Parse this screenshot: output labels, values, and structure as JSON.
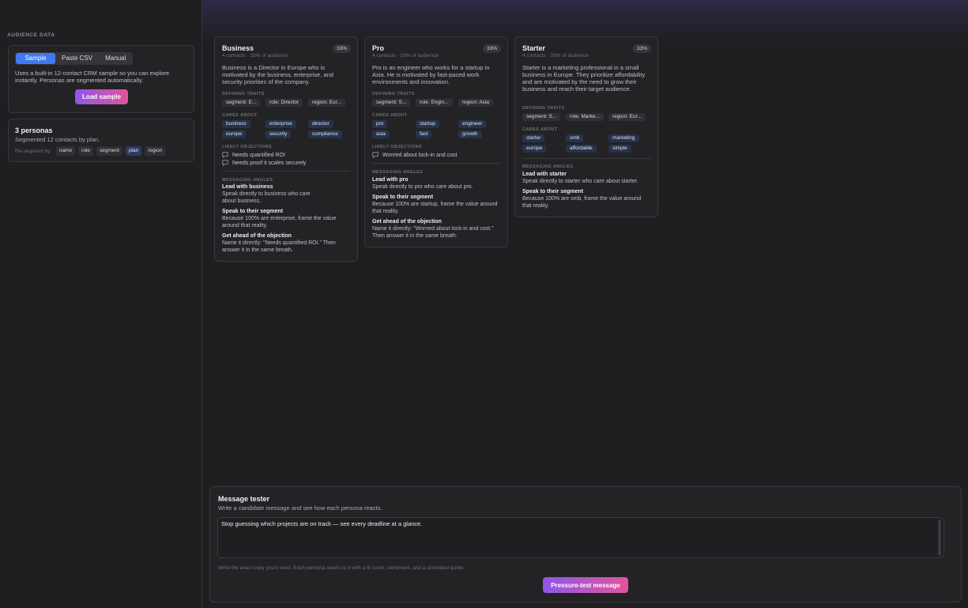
{
  "sidebar": {
    "section_label": "AUDIENCE DATA",
    "tabs": [
      "Sample",
      "Paste CSV",
      "Manual"
    ],
    "active_tab": "Sample",
    "description": "Uses a built-in 12-contact CRM sample so you can explore instantly. Personas are segmented automatically.",
    "load_button": "Load sample",
    "personas_title": "3 personas",
    "personas_subtitle": "Segmented 12 contacts by plan.",
    "resegment_label": "Re-segment by:",
    "resegment_options": [
      "name",
      "role",
      "segment",
      "plan",
      "region"
    ],
    "resegment_active": "plan"
  },
  "personas": [
    {
      "name": "Business",
      "share": "33%",
      "subtitle": "4 contacts · 33% of audience",
      "description": "Business is a Director in Europe who is motivated by the business, enterprise, and security priorities of the company.",
      "traits_label": "DEFINING TRAITS",
      "traits": [
        "segment: E...",
        "role: Director",
        "region: Eur..."
      ],
      "cares_label": "CARES ABOUT",
      "cares": [
        "business",
        "enterprise",
        "director",
        "europe",
        "security",
        "compliance"
      ],
      "objections_label": "LIKELY OBJECTIONS",
      "objections": [
        "Needs quantified ROI",
        "Needs proof it scales securely"
      ],
      "angles_label": "MESSAGING ANGLES",
      "angles": [
        {
          "title": "Lead with business",
          "text": "Speak directly to business who care about business."
        },
        {
          "title": "Speak to their segment",
          "text": "Because 100% are enterprise, frame the value around that reality."
        },
        {
          "title": "Get ahead of the objection",
          "text": "Name it directly: \"Needs quantified ROI.\" Then answer it in the same breath."
        }
      ]
    },
    {
      "name": "Pro",
      "share": "33%",
      "subtitle": "4 contacts · 33% of audience",
      "description": "Pro is an engineer who works for a startup in Asia. He is motivated by fast-paced work environments and innovation.",
      "traits_label": "DEFINING TRAITS",
      "traits": [
        "segment: S...",
        "role: Engin...",
        "region: Asia"
      ],
      "cares_label": "CARES ABOUT",
      "cares": [
        "pro",
        "startup",
        "engineer",
        "asia",
        "fast",
        "growth"
      ],
      "objections_label": "LIKELY OBJECTIONS",
      "objections": [
        "Worried about lock-in and cost"
      ],
      "angles_label": "MESSAGING ANGLES",
      "angles": [
        {
          "title": "Lead with pro",
          "text": "Speak directly to pro who care about pro."
        },
        {
          "title": "Speak to their segment",
          "text": "Because 100% are startup, frame the value around that reality."
        },
        {
          "title": "Get ahead of the objection",
          "text": "Name it directly: \"Worried about lock-in and cost.\" Then answer it in the same breath."
        }
      ]
    },
    {
      "name": "Starter",
      "share": "33%",
      "subtitle": "4 contacts · 33% of audience",
      "description": "Starter is a marketing professional in a small business in Europe. They prioritize affordability and are motivated by the need to grow their business and reach their target audience.",
      "traits_label": "DEFINING TRAITS",
      "traits": [
        "segment: S...",
        "role: Marke...",
        "region: Eur..."
      ],
      "cares_label": "CARES ABOUT",
      "cares": [
        "starter",
        "smb",
        "marketing",
        "europe",
        "affordable",
        "simple"
      ],
      "objections_label": "",
      "objections": [],
      "angles_label": "MESSAGING ANGLES",
      "angles": [
        {
          "title": "Lead with starter",
          "text": "Speak directly to starter who care about starter."
        },
        {
          "title": "Speak to their segment",
          "text": "Because 100% are smb, frame the value around that reality."
        }
      ]
    }
  ],
  "tester": {
    "title": "Message tester",
    "subtitle": "Write a candidate message and see how each persona reacts.",
    "message": "Stop guessing which projects are on track — see every deadline at a glance.",
    "hint": "Write the exact copy you'd send. Each persona reacts to it with a fit score, sentiment, and a simulated quote.",
    "button": "Pressure-test message"
  }
}
